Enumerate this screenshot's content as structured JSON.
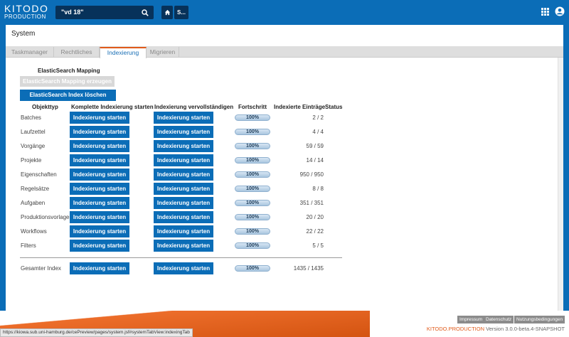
{
  "app": {
    "logo_line1": "KITODO",
    "logo_line2": "PRODUCTION",
    "search_value": "\"vd 18\"",
    "user_short": "S..."
  },
  "icons": {
    "search": "search-icon",
    "home": "home-icon",
    "apps": "grid-icon",
    "user": "user-icon"
  },
  "page": {
    "title": "System",
    "tabs": [
      "Taskmanager",
      "Rechtliches",
      "Indexierung",
      "Migrieren"
    ],
    "active_tab": "Indexierung"
  },
  "mapping": {
    "heading": "ElasticSearch Mapping",
    "create_button": "ElasticSearch Mapping erzeugen",
    "delete_button": "ElasticSearch Index löschen"
  },
  "table": {
    "headers": {
      "type": "Objekttyp",
      "full": "Komplette Indexierung starten",
      "complete": "Indexierung vervollständigen",
      "progress": "Fortschritt",
      "count": "Indexierte Einträge",
      "status": "Status"
    },
    "button_label": "Indexierung starten",
    "rows": [
      {
        "name": "Batches",
        "progress": "100%",
        "count": "2 / 2"
      },
      {
        "name": "Laufzettel",
        "progress": "100%",
        "count": "4 / 4"
      },
      {
        "name": "Vorgänge",
        "progress": "100%",
        "count": "59 / 59"
      },
      {
        "name": "Projekte",
        "progress": "100%",
        "count": "14 / 14"
      },
      {
        "name": "Eigenschaften",
        "progress": "100%",
        "count": "950 / 950"
      },
      {
        "name": "Regelsätze",
        "progress": "100%",
        "count": "8 / 8"
      },
      {
        "name": "Aufgaben",
        "progress": "100%",
        "count": "351 / 351"
      },
      {
        "name": "Produktionsvorlage",
        "progress": "100%",
        "count": "20 / 20"
      },
      {
        "name": "Workflows",
        "progress": "100%",
        "count": "22 / 22"
      },
      {
        "name": "Filters",
        "progress": "100%",
        "count": "5 / 5"
      }
    ],
    "total": {
      "name": "Gesamter Index",
      "progress": "100%",
      "count": "1435 / 1435"
    }
  },
  "footer": {
    "links": [
      "Impressum",
      "Datenschutz",
      "Nutzungsbedingungen"
    ],
    "brand": "KITODO.PRODUCTION",
    "version": "Version 3.0.0-beta.4-SNAPSHOT",
    "status_url": "https://kiowa.sub.uni-hamburg.de/cePreview/pages/system.jsf#systemTabView:indexingTab"
  },
  "colors": {
    "primary": "#0b6db7",
    "accent": "#e05a1a",
    "disabled": "#d8d8d8"
  }
}
